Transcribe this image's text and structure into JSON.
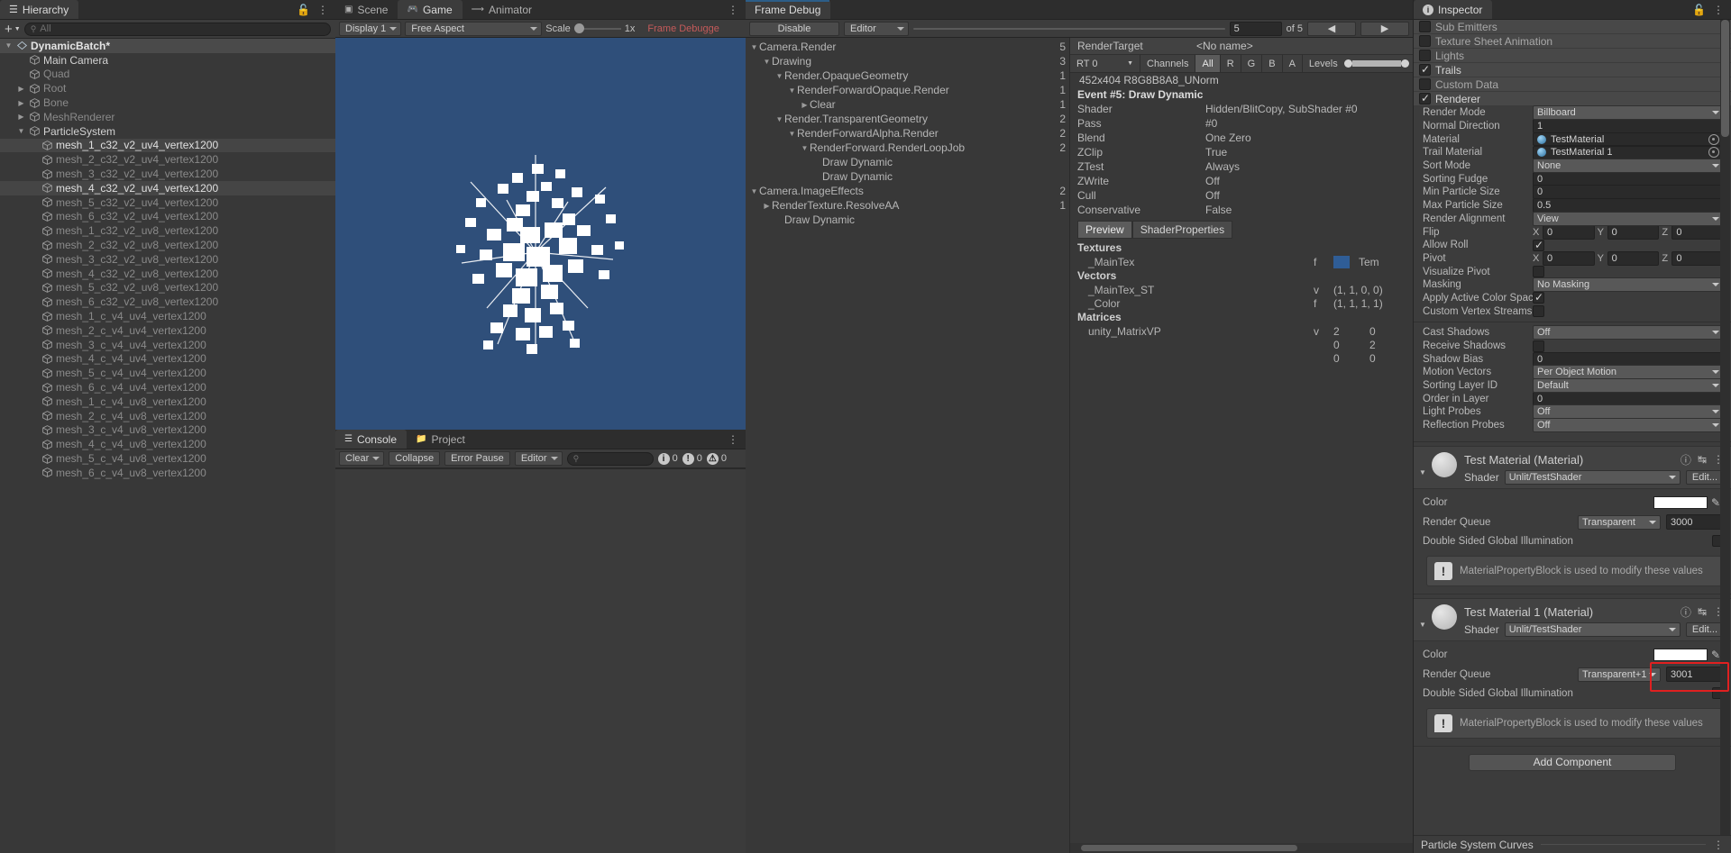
{
  "hierarchy": {
    "tab_label": "Hierarchy",
    "tab_icon": "hierarchy-icon",
    "add_label": "+",
    "search_placeholder": "All",
    "items": [
      {
        "label": "DynamicBatch*",
        "indent": 0,
        "arrow": "down",
        "icon": "scene-icon",
        "state": "selected-root"
      },
      {
        "label": "Main Camera",
        "indent": 1,
        "arrow": "none",
        "icon": "gameobject-icon",
        "state": "active"
      },
      {
        "label": "Quad",
        "indent": 1,
        "arrow": "none",
        "icon": "gameobject-icon",
        "state": "dim"
      },
      {
        "label": "Root",
        "indent": 1,
        "arrow": "right",
        "icon": "gameobject-icon",
        "state": "dim"
      },
      {
        "label": "Bone",
        "indent": 1,
        "arrow": "right",
        "icon": "gameobject-icon",
        "state": "dim"
      },
      {
        "label": "MeshRenderer",
        "indent": 1,
        "arrow": "right",
        "icon": "gameobject-icon",
        "state": "dim"
      },
      {
        "label": "ParticleSystem",
        "indent": 1,
        "arrow": "down",
        "icon": "gameobject-icon",
        "state": "active"
      },
      {
        "label": "mesh_1_c32_v2_uv4_vertex1200",
        "indent": 2,
        "arrow": "none",
        "icon": "gameobject-icon",
        "state": "sel-soft"
      },
      {
        "label": "mesh_2_c32_v2_uv4_vertex1200",
        "indent": 2,
        "arrow": "none",
        "icon": "gameobject-icon",
        "state": "dim"
      },
      {
        "label": "mesh_3_c32_v2_uv4_vertex1200",
        "indent": 2,
        "arrow": "none",
        "icon": "gameobject-icon",
        "state": "dim"
      },
      {
        "label": "mesh_4_c32_v2_uv4_vertex1200",
        "indent": 2,
        "arrow": "none",
        "icon": "gameobject-icon",
        "state": "sel-soft"
      },
      {
        "label": "mesh_5_c32_v2_uv4_vertex1200",
        "indent": 2,
        "arrow": "none",
        "icon": "gameobject-icon",
        "state": "dim"
      },
      {
        "label": "mesh_6_c32_v2_uv4_vertex1200",
        "indent": 2,
        "arrow": "none",
        "icon": "gameobject-icon",
        "state": "dim"
      },
      {
        "label": "mesh_1_c32_v2_uv8_vertex1200",
        "indent": 2,
        "arrow": "none",
        "icon": "gameobject-icon",
        "state": "dim"
      },
      {
        "label": "mesh_2_c32_v2_uv8_vertex1200",
        "indent": 2,
        "arrow": "none",
        "icon": "gameobject-icon",
        "state": "dim"
      },
      {
        "label": "mesh_3_c32_v2_uv8_vertex1200",
        "indent": 2,
        "arrow": "none",
        "icon": "gameobject-icon",
        "state": "dim"
      },
      {
        "label": "mesh_4_c32_v2_uv8_vertex1200",
        "indent": 2,
        "arrow": "none",
        "icon": "gameobject-icon",
        "state": "dim"
      },
      {
        "label": "mesh_5_c32_v2_uv8_vertex1200",
        "indent": 2,
        "arrow": "none",
        "icon": "gameobject-icon",
        "state": "dim"
      },
      {
        "label": "mesh_6_c32_v2_uv8_vertex1200",
        "indent": 2,
        "arrow": "none",
        "icon": "gameobject-icon",
        "state": "dim"
      },
      {
        "label": "mesh_1_c_v4_uv4_vertex1200",
        "indent": 2,
        "arrow": "none",
        "icon": "gameobject-icon",
        "state": "dim"
      },
      {
        "label": "mesh_2_c_v4_uv4_vertex1200",
        "indent": 2,
        "arrow": "none",
        "icon": "gameobject-icon",
        "state": "dim"
      },
      {
        "label": "mesh_3_c_v4_uv4_vertex1200",
        "indent": 2,
        "arrow": "none",
        "icon": "gameobject-icon",
        "state": "dim"
      },
      {
        "label": "mesh_4_c_v4_uv4_vertex1200",
        "indent": 2,
        "arrow": "none",
        "icon": "gameobject-icon",
        "state": "dim"
      },
      {
        "label": "mesh_5_c_v4_uv4_vertex1200",
        "indent": 2,
        "arrow": "none",
        "icon": "gameobject-icon",
        "state": "dim"
      },
      {
        "label": "mesh_6_c_v4_uv4_vertex1200",
        "indent": 2,
        "arrow": "none",
        "icon": "gameobject-icon",
        "state": "dim"
      },
      {
        "label": "mesh_1_c_v4_uv8_vertex1200",
        "indent": 2,
        "arrow": "none",
        "icon": "gameobject-icon",
        "state": "dim"
      },
      {
        "label": "mesh_2_c_v4_uv8_vertex1200",
        "indent": 2,
        "arrow": "none",
        "icon": "gameobject-icon",
        "state": "dim"
      },
      {
        "label": "mesh_3_c_v4_uv8_vertex1200",
        "indent": 2,
        "arrow": "none",
        "icon": "gameobject-icon",
        "state": "dim"
      },
      {
        "label": "mesh_4_c_v4_uv8_vertex1200",
        "indent": 2,
        "arrow": "none",
        "icon": "gameobject-icon",
        "state": "dim"
      },
      {
        "label": "mesh_5_c_v4_uv8_vertex1200",
        "indent": 2,
        "arrow": "none",
        "icon": "gameobject-icon",
        "state": "dim"
      },
      {
        "label": "mesh_6_c_v4_uv8_vertex1200",
        "indent": 2,
        "arrow": "none",
        "icon": "gameobject-icon",
        "state": "dim"
      }
    ]
  },
  "center": {
    "tabs": [
      {
        "label": "Scene",
        "icon": "scene-grid-icon",
        "active": false
      },
      {
        "label": "Game",
        "icon": "gamepad-icon",
        "active": true
      },
      {
        "label": "Animator",
        "icon": "animator-icon",
        "active": false
      }
    ],
    "game_toolbar": {
      "display": "Display 1",
      "aspect": "Free Aspect",
      "scale_label": "Scale",
      "scale_value": "1x",
      "frame_debugger_label": "Frame Debugge"
    },
    "console": {
      "tabs": [
        {
          "label": "Console",
          "icon": "console-icon",
          "active": true
        },
        {
          "label": "Project",
          "icon": "project-icon",
          "active": false
        }
      ],
      "clear_label": "Clear",
      "collapse_label": "Collapse",
      "error_pause_label": "Error Pause",
      "editor_label": "Editor",
      "search_placeholder": "",
      "counts": {
        "log": "0",
        "warn": "0",
        "error": "0"
      }
    }
  },
  "frame_debug": {
    "tab_label": "Frame Debug",
    "toolbar": {
      "disable_label": "Disable",
      "target_label": "Editor",
      "event_index": "5",
      "event_total": "of 5",
      "prev_label": "◀",
      "next_label": "▶"
    },
    "tree": [
      {
        "label": "Camera.Render",
        "indent": 0,
        "arrow": "down",
        "count": "5"
      },
      {
        "label": "Drawing",
        "indent": 1,
        "arrow": "down",
        "count": "3"
      },
      {
        "label": "Render.OpaqueGeometry",
        "indent": 2,
        "arrow": "down",
        "count": "1"
      },
      {
        "label": "RenderForwardOpaque.Render",
        "indent": 3,
        "arrow": "down",
        "count": "1"
      },
      {
        "label": "Clear",
        "indent": 4,
        "arrow": "right",
        "count": "1"
      },
      {
        "label": "Render.TransparentGeometry",
        "indent": 2,
        "arrow": "down",
        "count": "2"
      },
      {
        "label": "RenderForwardAlpha.Render",
        "indent": 3,
        "arrow": "down",
        "count": "2"
      },
      {
        "label": "RenderForward.RenderLoopJob",
        "indent": 4,
        "arrow": "down",
        "count": "2"
      },
      {
        "label": "Draw Dynamic",
        "indent": 5,
        "arrow": "none",
        "count": ""
      },
      {
        "label": "Draw Dynamic",
        "indent": 5,
        "arrow": "none",
        "count": ""
      },
      {
        "label": "Camera.ImageEffects",
        "indent": 0,
        "arrow": "down",
        "count": "2"
      },
      {
        "label": "RenderTexture.ResolveAA",
        "indent": 1,
        "arrow": "right",
        "count": "1"
      },
      {
        "label": "Draw Dynamic",
        "indent": 2,
        "arrow": "none",
        "count": ""
      }
    ],
    "render_target": {
      "label": "RenderTarget",
      "value": "<No name>",
      "rt_select": "RT 0",
      "channels_label": "Channels",
      "channels": [
        "All",
        "R",
        "G",
        "B",
        "A"
      ],
      "channels_active": "All",
      "levels_label": "Levels",
      "format": "452x404 R8G8B8A8_UNorm"
    },
    "event_title": "Event #5: Draw Dynamic",
    "state": [
      {
        "key": "Shader",
        "value": "Hidden/BlitCopy, SubShader #0"
      },
      {
        "key": "Pass",
        "value": "#0"
      },
      {
        "key": "Blend",
        "value": "One Zero"
      },
      {
        "key": "ZClip",
        "value": "True"
      },
      {
        "key": "ZTest",
        "value": "Always"
      },
      {
        "key": "ZWrite",
        "value": "Off"
      },
      {
        "key": "Cull",
        "value": "Off"
      },
      {
        "key": "Conservative",
        "value": "False"
      }
    ],
    "preview_tabs": [
      {
        "label": "Preview",
        "active": true
      },
      {
        "label": "ShaderProperties",
        "active": false
      }
    ],
    "shader_properties": {
      "textures_header": "Textures",
      "textures": [
        {
          "name": "_MainTex",
          "type": "f",
          "value": "Tem"
        }
      ],
      "vectors_header": "Vectors",
      "vectors": [
        {
          "name": "_MainTex_ST",
          "type": "v",
          "value": "(1, 1, 0, 0)"
        },
        {
          "name": "_Color",
          "type": "f",
          "value": "(1, 1, 1, 1)"
        }
      ],
      "matrices_header": "Matrices",
      "matrices": [
        {
          "name": "unity_MatrixVP",
          "type": "v",
          "rows": [
            [
              "2",
              "0"
            ],
            [
              "0",
              "2"
            ],
            [
              "0",
              "0"
            ]
          ]
        }
      ]
    }
  },
  "inspector": {
    "tab_label": "Inspector",
    "tab_icon": "info-icon",
    "lock_icon": "lock-icon",
    "kebab_icon": "kebab-icon",
    "modules": [
      {
        "label": "Sub Emitters",
        "checked": false
      },
      {
        "label": "Texture Sheet Animation",
        "checked": false
      },
      {
        "label": "Lights",
        "checked": false
      },
      {
        "label": "Trails",
        "checked": true
      },
      {
        "label": "Custom Data",
        "checked": false
      },
      {
        "label": "Renderer",
        "checked": true
      }
    ],
    "renderer_props": [
      {
        "label": "Render Mode",
        "type": "dropdown",
        "value": "Billboard"
      },
      {
        "label": "Normal Direction",
        "type": "text",
        "value": "1"
      },
      {
        "label": "Material",
        "type": "object",
        "value": "TestMaterial"
      },
      {
        "label": "Trail Material",
        "type": "object",
        "value": "TestMaterial 1"
      },
      {
        "label": "Sort Mode",
        "type": "dropdown",
        "value": "None"
      },
      {
        "label": "Sorting Fudge",
        "type": "text",
        "value": "0"
      },
      {
        "label": "Min Particle Size",
        "type": "text",
        "value": "0"
      },
      {
        "label": "Max Particle Size",
        "type": "text",
        "value": "0.5"
      },
      {
        "label": "Render Alignment",
        "type": "dropdown",
        "value": "View"
      },
      {
        "label": "Flip",
        "type": "xyz",
        "x": "0",
        "y": "0",
        "z": "0"
      },
      {
        "label": "Allow Roll",
        "type": "checkbox",
        "checked": true
      },
      {
        "label": "Pivot",
        "type": "xyz",
        "x": "0",
        "y": "0",
        "z": "0"
      },
      {
        "label": "Visualize Pivot",
        "type": "checkbox",
        "checked": false
      },
      {
        "label": "Masking",
        "type": "dropdown",
        "value": "No Masking"
      },
      {
        "label": "Apply Active Color Space",
        "type": "checkbox",
        "checked": true
      },
      {
        "label": "Custom Vertex Streams",
        "type": "checkbox",
        "checked": false
      }
    ],
    "shadow_props": [
      {
        "label": "Cast Shadows",
        "type": "dropdown",
        "value": "Off"
      },
      {
        "label": "Receive Shadows",
        "type": "checkbox",
        "checked": false
      },
      {
        "label": "Shadow Bias",
        "type": "text",
        "value": "0"
      },
      {
        "label": "Motion Vectors",
        "type": "dropdown",
        "value": "Per Object Motion"
      },
      {
        "label": "Sorting Layer ID",
        "type": "dropdown",
        "value": "Default"
      },
      {
        "label": "Order in Layer",
        "type": "text",
        "value": "0"
      },
      {
        "label": "Light Probes",
        "type": "dropdown",
        "value": "Off"
      },
      {
        "label": "Reflection Probes",
        "type": "dropdown",
        "value": "Off"
      }
    ],
    "axis_labels": {
      "x": "X",
      "y": "Y",
      "z": "Z"
    },
    "materials": [
      {
        "title": "Test Material (Material)",
        "shader_label": "Shader",
        "shader_value": "Unlit/TestShader",
        "edit_label": "Edit...",
        "color_label": "Color",
        "color_value": "#ffffff",
        "queue_label": "Render Queue",
        "queue_mode": "Transparent",
        "queue_value": "3000",
        "dsgi_label": "Double Sided Global Illumination",
        "dsgi_checked": false,
        "mpb_note": "MaterialPropertyBlock is used to modify these values",
        "highlighted": false
      },
      {
        "title": "Test Material 1 (Material)",
        "shader_label": "Shader",
        "shader_value": "Unlit/TestShader",
        "edit_label": "Edit...",
        "color_label": "Color",
        "color_value": "#ffffff",
        "queue_label": "Render Queue",
        "queue_mode": "Transparent+1",
        "queue_value": "3001",
        "dsgi_label": "Double Sided Global Illumination",
        "dsgi_checked": false,
        "mpb_note": "MaterialPropertyBlock is used to modify these values",
        "highlighted": true
      }
    ],
    "add_component_label": "Add Component",
    "curves_label": "Particle System Curves",
    "highlight_color": "#e02020"
  }
}
